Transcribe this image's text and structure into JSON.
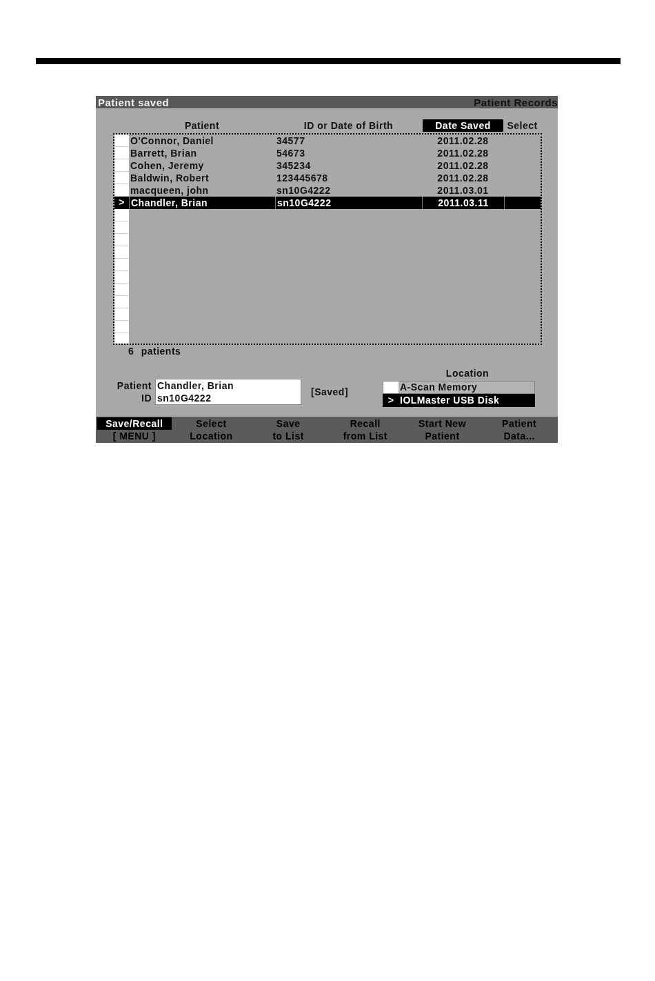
{
  "title_bar": {
    "title": "Patient saved",
    "section": "Patient Records"
  },
  "table": {
    "cursor": ">",
    "columns": [
      {
        "label": "Patient",
        "selected": false
      },
      {
        "label": "ID or Date of Birth",
        "selected": false
      },
      {
        "label": "Date Saved",
        "selected": true
      },
      {
        "label": "Select",
        "selected": false
      }
    ],
    "rows": [
      {
        "patient": "O'Connor, Daniel",
        "id": "34577",
        "date_saved": "2011.02.28",
        "selected": false
      },
      {
        "patient": "Barrett, Brian",
        "id": "54673",
        "date_saved": "2011.02.28",
        "selected": false
      },
      {
        "patient": "Cohen, Jeremy",
        "id": "345234",
        "date_saved": "2011.02.28",
        "selected": false
      },
      {
        "patient": "Baldwin, Robert",
        "id": "123445678",
        "date_saved": "2011.02.28",
        "selected": false
      },
      {
        "patient": "macqueen, john",
        "id": "sn10G4222",
        "date_saved": "2011.03.01",
        "selected": false
      },
      {
        "patient": "Chandler, Brian",
        "id": "sn10G4222",
        "date_saved": "2011.03.11",
        "selected": true
      }
    ]
  },
  "patient_count": "6 patients",
  "patient_entry": {
    "fields": [
      {
        "label": "Patient",
        "value": "Chandler, Brian"
      },
      {
        "label": "ID",
        "value": "sn10G4222"
      }
    ],
    "status": "[Saved]"
  },
  "location": {
    "heading": "Location",
    "cursor": ">",
    "items": [
      {
        "label": "A-Scan Memory",
        "selected": false
      },
      {
        "label": "IOLMaster USB Disk",
        "selected": true
      }
    ]
  },
  "softkeys": [
    {
      "lines": [
        "Save/Recall",
        "[ MENU ]"
      ],
      "selected": true
    },
    {
      "lines": [
        "Select",
        "Location"
      ],
      "selected": false
    },
    {
      "lines": [
        "Save",
        "to List"
      ],
      "selected": false
    },
    {
      "lines": [
        "Recall",
        "from List"
      ],
      "selected": false
    },
    {
      "lines": [
        "Start New",
        "Patient"
      ],
      "selected": false
    },
    {
      "lines": [
        "Patient",
        "Data..."
      ],
      "selected": false
    }
  ]
}
